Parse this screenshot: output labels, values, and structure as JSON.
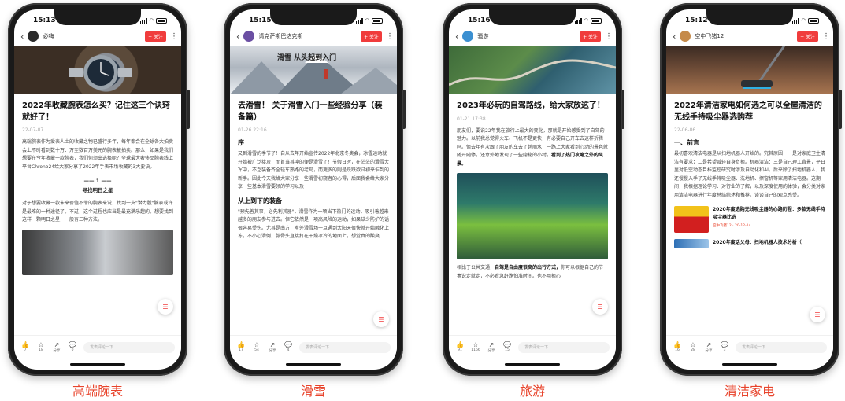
{
  "phones": [
    {
      "time": "15:13",
      "author": "必嗨",
      "follow": "+ 关注",
      "title": "2022年收藏腕表怎么买？记住这三个诀窍就好了！",
      "date": "22-07-07",
      "para1": "高端腕表作为爱表人士的收藏之物已盛行多年，每年都会在全球各大拍卖会上不时看到数十万、万至数百万美元的腕表被拍卖。那么，如果是我们想要在今年收藏一款腕表，我们何须出选择呢？全球最大奢侈品腕表线上平台Chrono24给大家分享了2022年手表市场收藏的3大要诀。",
      "divider": "—— 1 ——",
      "subhead": "寻找明日之星",
      "para2": "对于想要收藏一款未来价值不菲的腕表来说，找到一支\"潜力股\"腕表或许是最难的一种途径了。不过，这个过程也应当是最充满乐趣的。想要找到这样一颗明日之星，一般有三种方法。",
      "actions": [
        {
          "icon": "👍",
          "count": "7"
        },
        {
          "icon": "☆",
          "count": "18"
        },
        {
          "icon": "↗",
          "count": "分享"
        },
        {
          "icon": "💬",
          "count": "0"
        }
      ],
      "comment": "发表评论一下",
      "caption": "高端腕表"
    },
    {
      "time": "15:15",
      "author": "请克萨斯巴达克斯",
      "follow": "+ 关注",
      "hero_text": "滑雪 从头起到入门",
      "title": "去滑雪！ 关于滑雪入门一些经验分享（装备篇）",
      "date": "01-26 22:16",
      "section1": "序",
      "para1": "又到滑雪的季节了！自从去年开始宣传2022年北京冬奥会，冰雪运动就开始被广泛接及，而首当其冲的便是滑雪了！节假日时，在茫茫的滑雪大军中，不乏装备齐全轻车熟路的老鸟，而更多的则是跃跃欲试初来乍到的新手。因此今天我给大家分享一些滑雪初窥者的心得，后面我会给大家分享一些基本滑雪要领的学习以及",
      "section2": "从上到下的装备",
      "para2": "\"预先善其事，必先利其器\"，滑雪作为一项当下热门的运动，吸引着越来越多的朋友参与进去。但它依然是一项高风险的运动，如果缺少防护的话很容易受伤。尤其是南方，室外滑雪场一旦遇到太阳天很快就开始融化上冻，不小心滑倒，膝骨头直接打在干燥冰冷的地面上，想觉真的酸爽",
      "actions": [
        {
          "icon": "👍",
          "count": "17"
        },
        {
          "icon": "☆",
          "count": "54"
        },
        {
          "icon": "↗",
          "count": "分享"
        },
        {
          "icon": "💬",
          "count": "4"
        }
      ],
      "comment": "发表评论一下",
      "caption": "滑雪"
    },
    {
      "time": "15:16",
      "author": "骚游",
      "follow": "+ 关注",
      "title": "2023年必玩的自驾路线，给大家放这了！",
      "date": "01-21 17:38",
      "para1": "朋友们，要说22年我在旅行上最大的变化，那就是开始感受到了自驾的魅力。以前我总觉得火车、飞机不是更快，有必要自己开车去这样折腾吗。但去年有次跟了朋友的车去了趟丽水，一路上大家看到心动的景色就随开随停，还意外地发现了一些隐秘的小村，",
      "para1_bold": "看到了热门攻略之外的风景。",
      "para2": "相比于公共交通，",
      "para2_bold": "自驾是自由度很高的出行方式，",
      "para2_rest": "你可以根据自己的节奏说走就走，不必看急赶路怕准时间。也不用担心",
      "actions": [
        {
          "icon": "👍",
          "count": "91"
        },
        {
          "icon": "☆",
          "count": "1166"
        },
        {
          "icon": "↗",
          "count": "分享"
        },
        {
          "icon": "💬",
          "count": "15"
        }
      ],
      "comment": "发表评论一下",
      "caption": "旅游"
    },
    {
      "time": "15:12",
      "author": "空中飞猪12",
      "follow": "+ 关注",
      "title": "2022年清洁家电如何选之可以全屋清洁的无线手持吸尘器选购荐",
      "date": "22-06-06",
      "section1": "一、前言",
      "para1": "最初喜欢清洁电器是从扫地机器人开始的。究其原因：一是对家庭卫生清洁有要求；二是希望减轻自身负担。机器清洁：三是自己理工背景，平日里对低空动态目标监控研究时涉及自动化和AI。后来除了扫地机器人，我还慢慢入手了无线手持吸尘器、洗地机、擦窗机等家用清洁电器。这期间，我根据理论学习、对行业的了解，以及深度使用的体验，会分类对家用清洁电器进行年度总结综述和推荐。谈谈自己的观点感受。",
      "rec1_title": "2020年度选购无线吸尘器的心路历程：多款无线手持吸尘器比选",
      "rec1_meta": "空中飞猪12 · 20-12-14",
      "rec2_title": "2020年度话父母：扫地机器人技术分析（",
      "actions": [
        {
          "icon": "👍",
          "count": "16"
        },
        {
          "icon": "☆",
          "count": "28"
        },
        {
          "icon": "↗",
          "count": "分享"
        },
        {
          "icon": "💬",
          "count": "3"
        }
      ],
      "comment": "发表评论一下",
      "caption": "清洁家电"
    }
  ]
}
